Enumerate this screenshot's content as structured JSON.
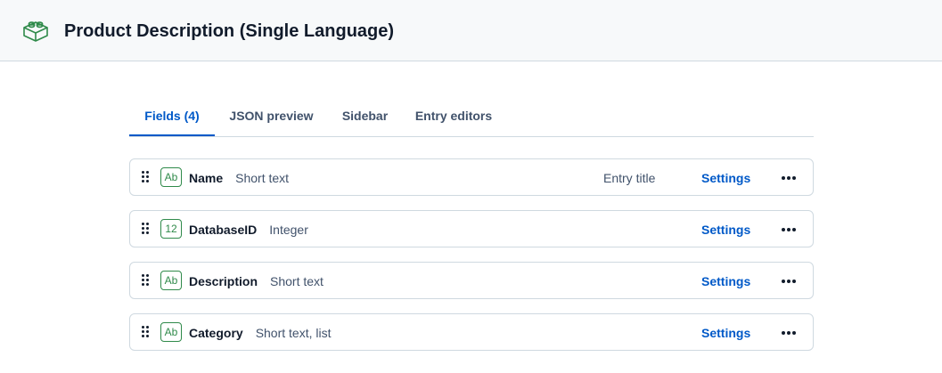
{
  "header": {
    "title": "Product Description (Single Language)",
    "icon": "content-type-blocks-icon",
    "accent": "#2f8a4a"
  },
  "tabs": [
    {
      "label": "Fields (4)",
      "active": true
    },
    {
      "label": "JSON preview",
      "active": false
    },
    {
      "label": "Sidebar",
      "active": false
    },
    {
      "label": "Entry editors",
      "active": false
    }
  ],
  "fields": [
    {
      "badge": "Ab",
      "name": "Name",
      "type": "Short text",
      "tag": "Entry title",
      "settings": "Settings"
    },
    {
      "badge": "12",
      "name": "DatabaseID",
      "type": "Integer",
      "tag": "",
      "settings": "Settings"
    },
    {
      "badge": "Ab",
      "name": "Description",
      "type": "Short text",
      "tag": "",
      "settings": "Settings"
    },
    {
      "badge": "Ab",
      "name": "Category",
      "type": "Short text, list",
      "tag": "",
      "settings": "Settings"
    }
  ],
  "colors": {
    "link": "#0059c8",
    "badge": "#2f8a4a",
    "border": "#cfd9e0"
  }
}
